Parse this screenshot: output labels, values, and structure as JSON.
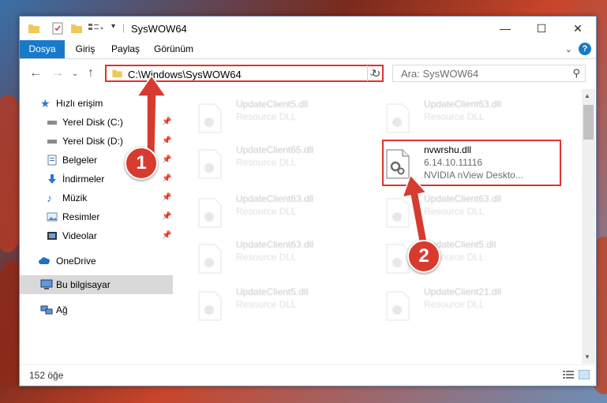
{
  "window": {
    "title": "SysWOW64",
    "controls": {
      "minimize": "—",
      "maximize": "☐",
      "close": "✕"
    }
  },
  "ribbon": {
    "tabs": [
      "Dosya",
      "Giriş",
      "Paylaş",
      "Görünüm"
    ],
    "help": "?"
  },
  "nav": {
    "address": "C:\\Windows\\SysWOW64",
    "search_placeholder": "Ara: SysWOW64"
  },
  "sidebar": {
    "items": [
      {
        "label": "Hızlı erişim",
        "icon": "star-icon",
        "pinned": false
      },
      {
        "label": "Yerel Disk (C:)",
        "icon": "drive-icon",
        "pinned": true
      },
      {
        "label": "Yerel Disk (D:)",
        "icon": "drive-icon",
        "pinned": true
      },
      {
        "label": "Belgeler",
        "icon": "documents-icon",
        "pinned": true
      },
      {
        "label": "İndirmeler",
        "icon": "download-icon",
        "pinned": true
      },
      {
        "label": "Müzik",
        "icon": "music-icon",
        "pinned": true
      },
      {
        "label": "Resimler",
        "icon": "pictures-icon",
        "pinned": true
      },
      {
        "label": "Videolar",
        "icon": "video-icon",
        "pinned": true
      },
      {
        "label": "OneDrive",
        "icon": "cloud-icon",
        "pinned": false
      },
      {
        "label": "Bu bilgisayar",
        "icon": "computer-icon",
        "pinned": false
      },
      {
        "label": "Ağ",
        "icon": "network-icon",
        "pinned": false
      }
    ]
  },
  "files": [
    {
      "name": "UpdateClient5.dll",
      "desc": "Resource DLL",
      "faded": true
    },
    {
      "name": "UpdateClient63.dll",
      "desc": "Resource DLL",
      "faded": true
    },
    {
      "name": "UpdateClient65.dll",
      "desc": "Resource DLL",
      "faded": true
    },
    {
      "name": "nvwrshu.dll",
      "desc": "6.14.10.11116",
      "desc2": "NVIDIA nView Deskto...",
      "faded": false
    },
    {
      "name": "UpdateClient63.dll",
      "desc": "Resource DLL",
      "faded": true
    },
    {
      "name": "UpdateClient63.dll",
      "desc": "Resource DLL",
      "faded": true
    },
    {
      "name": "UpdateClient63.dll",
      "desc": "Resource DLL",
      "faded": true
    },
    {
      "name": "UpdateClient5.dll",
      "desc": "Resource DLL",
      "faded": true
    },
    {
      "name": "UpdateClient5.dll",
      "desc": "Resource DLL",
      "faded": true
    },
    {
      "name": "UpdateClient21.dll",
      "desc": "Resource DLL",
      "faded": true
    }
  ],
  "status": {
    "count": "152 öğe"
  },
  "annotations": {
    "badge1": "1",
    "badge2": "2",
    "color": "#d73b2f"
  }
}
